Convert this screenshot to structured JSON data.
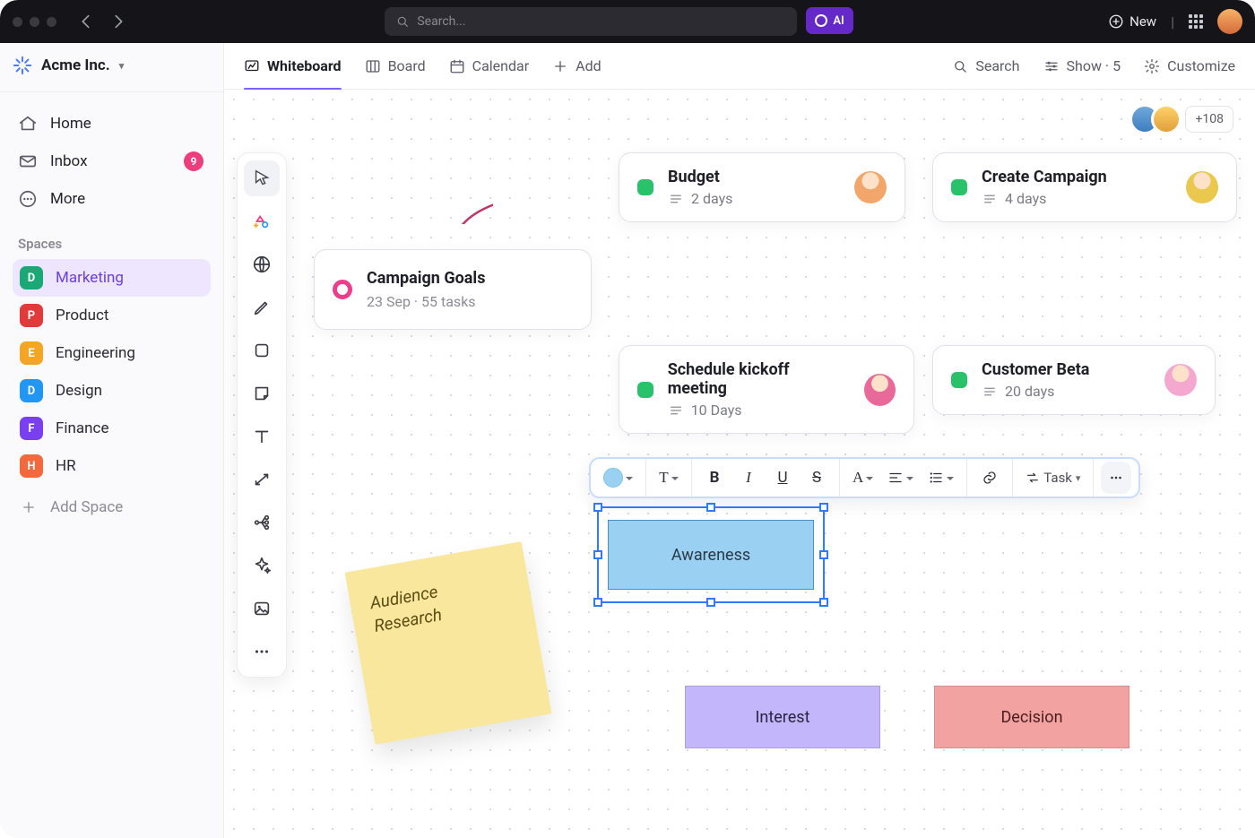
{
  "titlebar": {
    "search_placeholder": "Search...",
    "ai_label": "AI",
    "new_label": "New"
  },
  "workspace": {
    "name": "Acme Inc."
  },
  "sidebar": {
    "home": "Home",
    "inbox": "Inbox",
    "inbox_badge": "9",
    "more": "More",
    "section": "Spaces",
    "spaces": [
      {
        "letter": "D",
        "label": "Marketing",
        "color": "#1aa876",
        "active": true
      },
      {
        "letter": "P",
        "label": "Product",
        "color": "#e13a3a",
        "active": false
      },
      {
        "letter": "E",
        "label": "Engineering",
        "color": "#f5a524",
        "active": false
      },
      {
        "letter": "D",
        "label": "Design",
        "color": "#2296f3",
        "active": false
      },
      {
        "letter": "F",
        "label": "Finance",
        "color": "#7b3ff2",
        "active": false
      },
      {
        "letter": "H",
        "label": "HR",
        "color": "#f5683c",
        "active": false
      }
    ],
    "add_space": "Add Space"
  },
  "views": {
    "whiteboard": "Whiteboard",
    "board": "Board",
    "calendar": "Calendar",
    "add": "Add",
    "search": "Search",
    "show": "Show · 5",
    "customize": "Customize"
  },
  "presence": {
    "more": "+108"
  },
  "cards": {
    "goals": {
      "title": "Campaign Goals",
      "subtitle": "23 Sep  ·  55 tasks"
    },
    "budget": {
      "title": "Budget",
      "subtitle": "2 days"
    },
    "create": {
      "title": "Create Campaign",
      "subtitle": "4 days"
    },
    "kickoff": {
      "title": "Schedule kickoff meeting",
      "subtitle": "10 Days"
    },
    "beta": {
      "title": "Customer Beta",
      "subtitle": "20 days"
    }
  },
  "sticky": {
    "text_line1": "Audience",
    "text_line2": "Research"
  },
  "fmt": {
    "task_label": "Task"
  },
  "shapes": {
    "awareness": "Awareness",
    "interest": "Interest",
    "decision": "Decision"
  }
}
